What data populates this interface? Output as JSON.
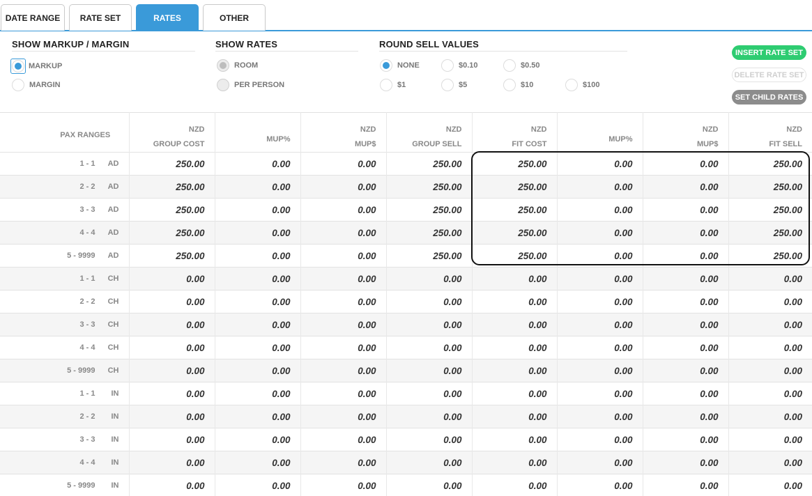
{
  "tabs": [
    {
      "label": "DATE RANGE",
      "active": false
    },
    {
      "label": "RATE SET",
      "active": false
    },
    {
      "label": "RATES",
      "active": true
    },
    {
      "label": "OTHER",
      "active": false
    }
  ],
  "markup_section": {
    "title": "SHOW MARKUP / MARGIN",
    "options": [
      {
        "label": "MARKUP",
        "checked": true
      },
      {
        "label": "MARGIN",
        "checked": false
      }
    ]
  },
  "rates_section": {
    "title": "SHOW RATES",
    "options": [
      {
        "label": "ROOM",
        "checked": true
      },
      {
        "label": "PER PERSON",
        "checked": false
      }
    ]
  },
  "round_section": {
    "title": "ROUND SELL VALUES",
    "options": [
      {
        "label": "NONE",
        "checked": true
      },
      {
        "label": "$0.10",
        "checked": false
      },
      {
        "label": "$0.50",
        "checked": false
      },
      {
        "label": "$1",
        "checked": false
      },
      {
        "label": "$5",
        "checked": false
      },
      {
        "label": "$10",
        "checked": false
      },
      {
        "label": "$100",
        "checked": false
      }
    ]
  },
  "buttons": {
    "insert": "INSERT RATE SET",
    "delete": "DELETE RATE SET",
    "child": "SET CHILD RATES"
  },
  "table": {
    "headers": [
      {
        "top": "",
        "bottom": "PAX RANGES"
      },
      {
        "top": "NZD",
        "bottom": "GROUP COST"
      },
      {
        "top": "",
        "bottom": "MUP%"
      },
      {
        "top": "NZD",
        "bottom": "MUP$"
      },
      {
        "top": "NZD",
        "bottom": "GROUP SELL"
      },
      {
        "top": "NZD",
        "bottom": "FIT COST"
      },
      {
        "top": "",
        "bottom": "MUP%"
      },
      {
        "top": "NZD",
        "bottom": "MUP$"
      },
      {
        "top": "NZD",
        "bottom": "FIT SELL"
      }
    ],
    "rows": [
      {
        "range": "1 - 1",
        "type": "AD",
        "values": [
          "250.00",
          "0.00",
          "0.00",
          "250.00",
          "250.00",
          "0.00",
          "0.00",
          "250.00"
        ]
      },
      {
        "range": "2 - 2",
        "type": "AD",
        "values": [
          "250.00",
          "0.00",
          "0.00",
          "250.00",
          "250.00",
          "0.00",
          "0.00",
          "250.00"
        ]
      },
      {
        "range": "3 - 3",
        "type": "AD",
        "values": [
          "250.00",
          "0.00",
          "0.00",
          "250.00",
          "250.00",
          "0.00",
          "0.00",
          "250.00"
        ]
      },
      {
        "range": "4 - 4",
        "type": "AD",
        "values": [
          "250.00",
          "0.00",
          "0.00",
          "250.00",
          "250.00",
          "0.00",
          "0.00",
          "250.00"
        ]
      },
      {
        "range": "5 - 9999",
        "type": "AD",
        "values": [
          "250.00",
          "0.00",
          "0.00",
          "250.00",
          "250.00",
          "0.00",
          "0.00",
          "250.00"
        ]
      },
      {
        "range": "1 - 1",
        "type": "CH",
        "values": [
          "0.00",
          "0.00",
          "0.00",
          "0.00",
          "0.00",
          "0.00",
          "0.00",
          "0.00"
        ]
      },
      {
        "range": "2 - 2",
        "type": "CH",
        "values": [
          "0.00",
          "0.00",
          "0.00",
          "0.00",
          "0.00",
          "0.00",
          "0.00",
          "0.00"
        ]
      },
      {
        "range": "3 - 3",
        "type": "CH",
        "values": [
          "0.00",
          "0.00",
          "0.00",
          "0.00",
          "0.00",
          "0.00",
          "0.00",
          "0.00"
        ]
      },
      {
        "range": "4 - 4",
        "type": "CH",
        "values": [
          "0.00",
          "0.00",
          "0.00",
          "0.00",
          "0.00",
          "0.00",
          "0.00",
          "0.00"
        ]
      },
      {
        "range": "5 - 9999",
        "type": "CH",
        "values": [
          "0.00",
          "0.00",
          "0.00",
          "0.00",
          "0.00",
          "0.00",
          "0.00",
          "0.00"
        ]
      },
      {
        "range": "1 - 1",
        "type": "IN",
        "values": [
          "0.00",
          "0.00",
          "0.00",
          "0.00",
          "0.00",
          "0.00",
          "0.00",
          "0.00"
        ]
      },
      {
        "range": "2 - 2",
        "type": "IN",
        "values": [
          "0.00",
          "0.00",
          "0.00",
          "0.00",
          "0.00",
          "0.00",
          "0.00",
          "0.00"
        ]
      },
      {
        "range": "3 - 3",
        "type": "IN",
        "values": [
          "0.00",
          "0.00",
          "0.00",
          "0.00",
          "0.00",
          "0.00",
          "0.00",
          "0.00"
        ]
      },
      {
        "range": "4 - 4",
        "type": "IN",
        "values": [
          "0.00",
          "0.00",
          "0.00",
          "0.00",
          "0.00",
          "0.00",
          "0.00",
          "0.00"
        ]
      },
      {
        "range": "5 - 9999",
        "type": "IN",
        "values": [
          "0.00",
          "0.00",
          "0.00",
          "0.00",
          "0.00",
          "0.00",
          "0.00",
          "0.00"
        ]
      }
    ]
  },
  "colors": {
    "accent": "#3a9ad9",
    "insert_button": "#2ecc71",
    "child_button": "#8c8c8c",
    "alt_row": "#f5f5f5"
  }
}
